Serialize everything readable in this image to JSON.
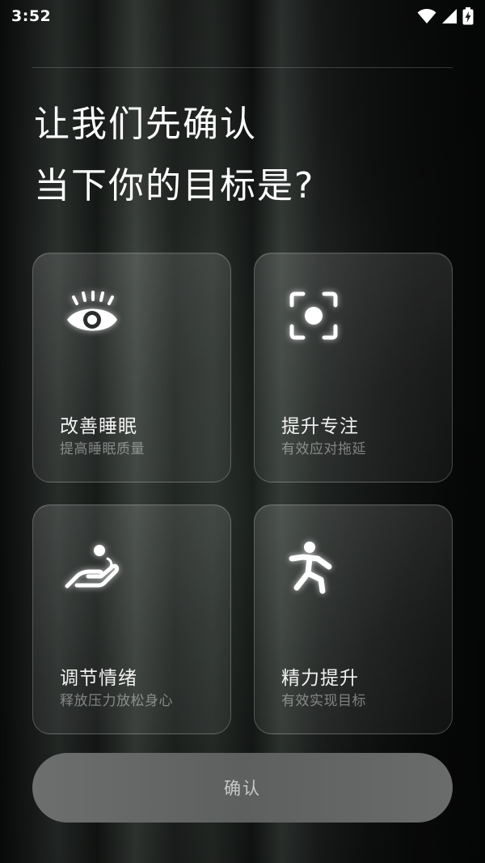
{
  "status_bar": {
    "time": "3:52",
    "icons": [
      "wifi-icon",
      "cellular-signal-icon",
      "battery-charging-icon"
    ]
  },
  "headline": {
    "line1": "让我们先确认",
    "line2": "当下你的目标是?"
  },
  "goals": [
    {
      "icon": "eye-icon",
      "title": "改善睡眠",
      "subtitle": "提高睡眠质量"
    },
    {
      "icon": "focus-target-icon",
      "title": "提升专注",
      "subtitle": "有效应对拖延"
    },
    {
      "icon": "hand-release-icon",
      "title": "调节情绪",
      "subtitle": "释放压力放松身心"
    },
    {
      "icon": "running-person-icon",
      "title": "精力提升",
      "subtitle": "有效实现目标"
    }
  ],
  "confirm_button": {
    "label": "确认"
  },
  "colors": {
    "background": "#141715",
    "card_border": "rgba(255,255,255,0.22)",
    "button": "#656766"
  }
}
